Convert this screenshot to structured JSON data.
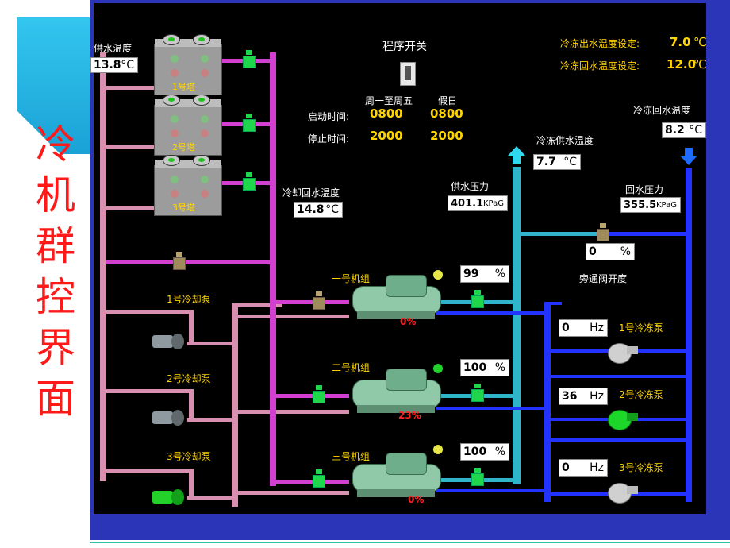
{
  "slide_title_chars": [
    "冷",
    "机",
    "群",
    "控",
    "界",
    "面"
  ],
  "program_switch": {
    "label": "程序开关"
  },
  "schedule": {
    "weekday_header": "周一至周五",
    "holiday_header": "假日",
    "start_label": "启动时间:",
    "stop_label": "停止时间:",
    "weekday_start": "0800",
    "holiday_start": "0800",
    "weekday_stop": "2000",
    "holiday_stop": "2000"
  },
  "setpoints": {
    "supply_label": "冷冻出水温度设定:",
    "supply_value": "7.0",
    "return_label": "冷冻回水温度设定:",
    "return_value": "12.0",
    "unit": "℃"
  },
  "supply_water_temp": {
    "label": "供水温度",
    "value": "13.8",
    "unit": "°C"
  },
  "cooling_return_temp": {
    "label": "冷却回水温度",
    "value": "14.8",
    "unit": "°C"
  },
  "chilled_supply_temp": {
    "label": "冷冻供水温度",
    "value": "7.7",
    "unit": "°C"
  },
  "chilled_return_temp": {
    "label": "冷冻回水温度",
    "value": "8.2",
    "unit": "°C"
  },
  "supply_pressure": {
    "label": "供水压力",
    "value": "401.1",
    "unit": "KPaG"
  },
  "return_pressure": {
    "label": "回水压力",
    "value": "355.5",
    "unit": "KPaG"
  },
  "bypass_valve": {
    "label": "旁通阀开度",
    "value": "0",
    "unit": "%"
  },
  "towers": [
    {
      "label": "1号塔"
    },
    {
      "label": "2号塔"
    },
    {
      "label": "3号塔"
    }
  ],
  "cooling_pumps": [
    {
      "label": "1号冷却泵",
      "running": false
    },
    {
      "label": "2号冷却泵",
      "running": false
    },
    {
      "label": "3号冷却泵",
      "running": true
    }
  ],
  "chillers": [
    {
      "label": "一号机组",
      "load": "0%",
      "valve_open": "99",
      "unit": "%",
      "indicator": "#e8e84a"
    },
    {
      "label": "二号机组",
      "load": "23%",
      "valve_open": "100",
      "unit": "%",
      "indicator": "#22d22a"
    },
    {
      "label": "三号机组",
      "load": "0%",
      "valve_open": "100",
      "unit": "%",
      "indicator": "#e8e84a"
    }
  ],
  "chilled_pumps": [
    {
      "label": "1号冷冻泵",
      "freq": "0",
      "unit": "Hz",
      "running": false
    },
    {
      "label": "2号冷冻泵",
      "freq": "36",
      "unit": "Hz",
      "running": true
    },
    {
      "label": "3号冷冻泵",
      "freq": "0",
      "unit": "Hz",
      "running": false
    }
  ]
}
